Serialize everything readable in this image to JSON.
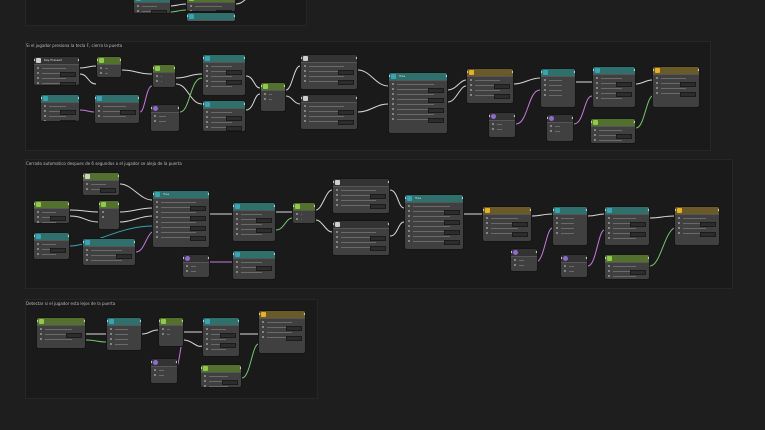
{
  "colors": {
    "background": "#1e1e1e",
    "frame": "#1a1a1a",
    "node": "#404040",
    "wire_exec": "#d9d9d9",
    "wire_purple": "#c77adf",
    "wire_green": "#76c76f",
    "wire_teal": "#39a3b3",
    "accent_green": "#8fca4a",
    "accent_gold": "#e7b127",
    "accent_purple": "#8f6bd1"
  },
  "frames": [
    {
      "id": "frame-top",
      "title": ""
    },
    {
      "id": "frame-1",
      "title": "Si el jugador presiona la tecla F, cierra la puerta"
    },
    {
      "id": "frame-2",
      "title": "Cerrado automatico despues de 6 segundos o el jugador se aleja de la puerta"
    },
    {
      "id": "frame-3",
      "title": "Detectar si el jugador esta lejos de la puerta"
    }
  ],
  "nodes": [
    {
      "id": "t1",
      "title": "",
      "icon": "teal-icon"
    },
    {
      "id": "t2",
      "title": "",
      "icon": "green-icon"
    },
    {
      "id": "t3",
      "title": "",
      "icon": "teal-icon"
    },
    {
      "id": "a1",
      "title": "Key Pressed",
      "icon": "white-icon"
    },
    {
      "id": "a2",
      "title": "",
      "icon": "teal-icon"
    },
    {
      "id": "a3",
      "title": "",
      "icon": "green-icon"
    },
    {
      "id": "a4",
      "title": "",
      "icon": "green-icon"
    },
    {
      "id": "a5",
      "title": "",
      "icon": "teal-icon"
    },
    {
      "id": "a6",
      "title": "",
      "icon": "purple-icon"
    },
    {
      "id": "a7",
      "title": "",
      "icon": "green-icon"
    },
    {
      "id": "a8",
      "title": "",
      "icon": "teal-icon"
    },
    {
      "id": "a9",
      "title": "",
      "icon": "teal-icon"
    },
    {
      "id": "a10",
      "title": "",
      "icon": "green-icon"
    },
    {
      "id": "a11",
      "title": "",
      "icon": "white-icon"
    },
    {
      "id": "a12",
      "title": "",
      "icon": "white-icon"
    },
    {
      "id": "a13",
      "title": "Tree",
      "icon": "teal-icon"
    },
    {
      "id": "a14",
      "title": "",
      "icon": "gold-icon"
    },
    {
      "id": "a15",
      "title": "",
      "icon": "purple-icon"
    },
    {
      "id": "a16",
      "title": "",
      "icon": "teal-icon"
    },
    {
      "id": "a17",
      "title": "",
      "icon": "purple-icon"
    },
    {
      "id": "a18",
      "title": "",
      "icon": "teal-icon"
    },
    {
      "id": "a19",
      "title": "",
      "icon": "green-icon"
    },
    {
      "id": "a20",
      "title": "",
      "icon": "gold-icon"
    },
    {
      "id": "b1",
      "title": "",
      "icon": "white-icon"
    },
    {
      "id": "b2",
      "title": "",
      "icon": "green-icon"
    },
    {
      "id": "b3",
      "title": "",
      "icon": "green-icon"
    },
    {
      "id": "b4",
      "title": "",
      "icon": "teal-icon"
    },
    {
      "id": "b5",
      "title": "",
      "icon": "green-icon"
    },
    {
      "id": "b6",
      "title": "",
      "icon": "teal-icon"
    },
    {
      "id": "b7",
      "title": "Tree",
      "icon": "teal-icon"
    },
    {
      "id": "b8",
      "title": "",
      "icon": "purple-icon"
    },
    {
      "id": "b9",
      "title": "",
      "icon": "teal-icon"
    },
    {
      "id": "b10",
      "title": "",
      "icon": "teal-icon"
    },
    {
      "id": "b11",
      "title": "",
      "icon": "green-icon"
    },
    {
      "id": "b12",
      "title": "",
      "icon": "white-icon"
    },
    {
      "id": "b13",
      "title": "",
      "icon": "white-icon"
    },
    {
      "id": "b14",
      "title": "Tree",
      "icon": "teal-icon"
    },
    {
      "id": "b15",
      "title": "",
      "icon": "gold-icon"
    },
    {
      "id": "b16",
      "title": "",
      "icon": "purple-icon"
    },
    {
      "id": "b17",
      "title": "",
      "icon": "teal-icon"
    },
    {
      "id": "b18",
      "title": "",
      "icon": "purple-icon"
    },
    {
      "id": "b19",
      "title": "",
      "icon": "teal-icon"
    },
    {
      "id": "b20",
      "title": "",
      "icon": "green-icon"
    },
    {
      "id": "b21",
      "title": "",
      "icon": "gold-icon"
    },
    {
      "id": "c1",
      "title": "",
      "icon": "green-icon"
    },
    {
      "id": "c2",
      "title": "",
      "icon": "teal-icon"
    },
    {
      "id": "c3",
      "title": "",
      "icon": "green-icon"
    },
    {
      "id": "c4",
      "title": "",
      "icon": "purple-icon"
    },
    {
      "id": "c5",
      "title": "",
      "icon": "teal-icon"
    },
    {
      "id": "c6",
      "title": "",
      "icon": "green-icon"
    },
    {
      "id": "c7",
      "title": "",
      "icon": "gold-icon"
    }
  ]
}
